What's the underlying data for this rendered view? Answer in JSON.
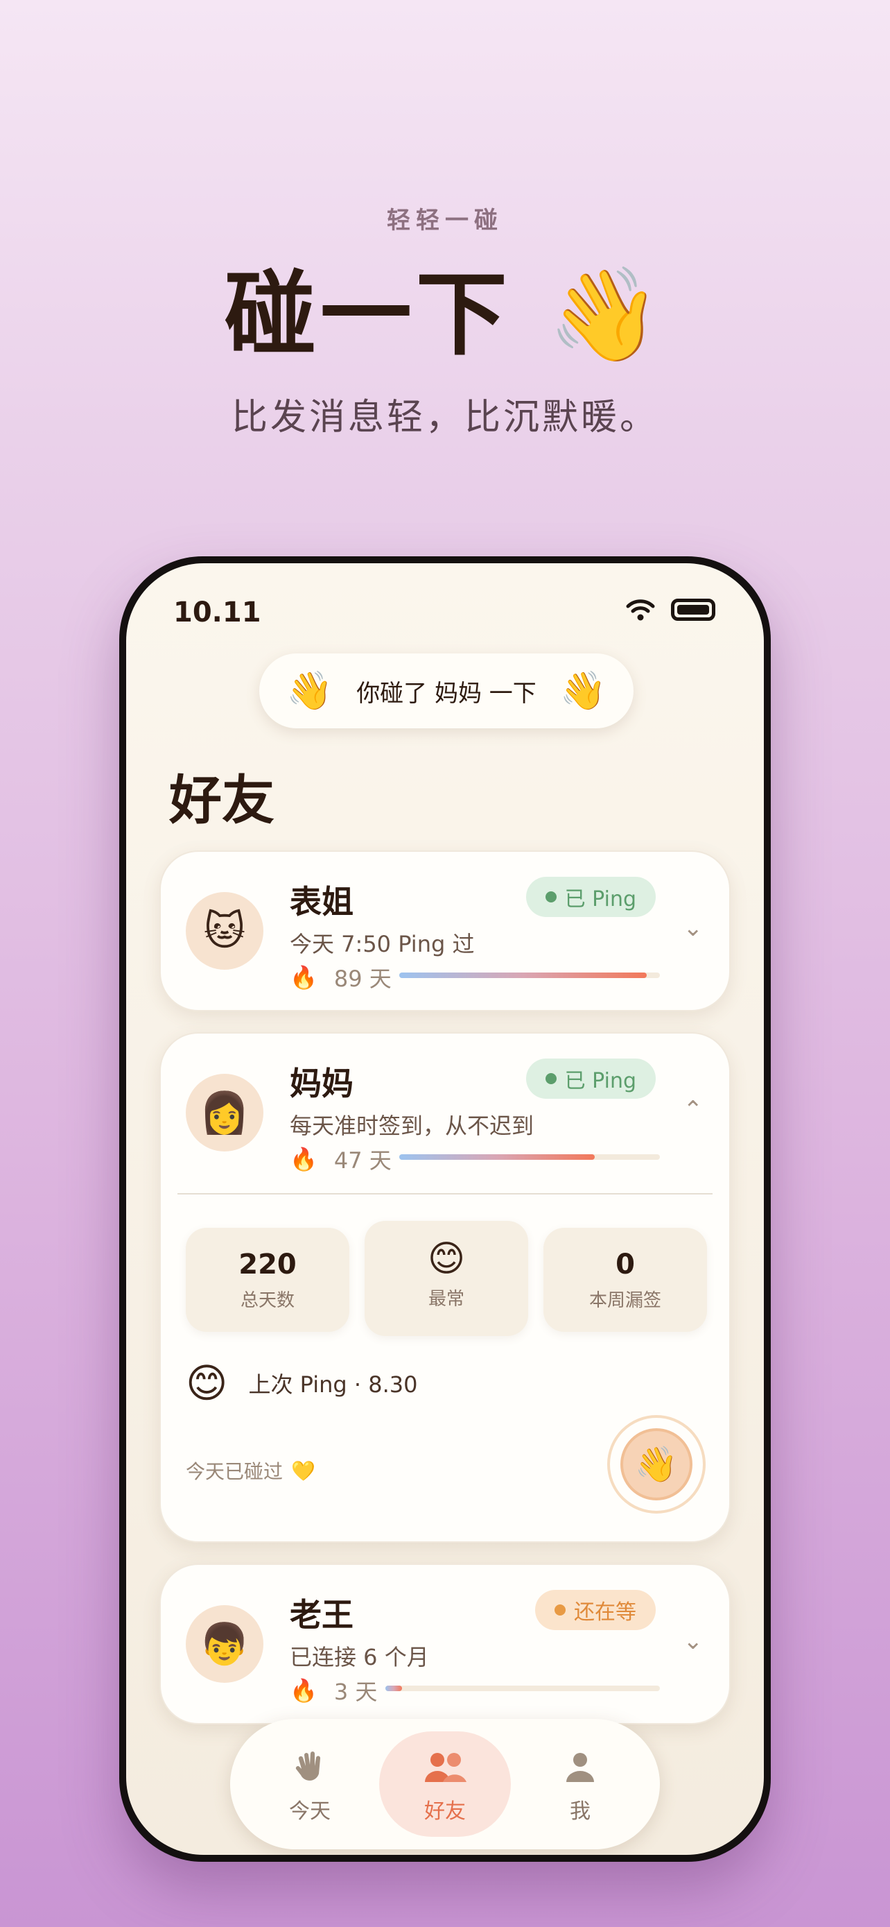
{
  "hero": {
    "kicker": "轻轻一碰",
    "headline": "碰一下 👋",
    "tagline": "比发消息轻，比沉默暖。"
  },
  "status_bar": {
    "time": "10.11"
  },
  "toast": {
    "left_emoji": "👋",
    "text": "你碰了 妈妈 一下",
    "right_emoji": "👋"
  },
  "section_title": "好友",
  "friends": [
    {
      "avatar": "🐱",
      "name": "表姐",
      "badge": "已 Ping",
      "badge_status": "pinged",
      "subtitle": "今天 7:50 Ping 过",
      "flame": "🔥",
      "streak": "89 天",
      "streak_progress": 0.95,
      "chevron": "⌄",
      "expanded": false
    },
    {
      "avatar": "👩",
      "name": "妈妈",
      "badge": "已 Ping",
      "badge_status": "pinged",
      "subtitle": "每天准时签到，从不迟到",
      "flame": "🔥",
      "streak": "47 天",
      "streak_progress": 0.75,
      "chevron": "⌃",
      "expanded": true,
      "stats": [
        {
          "value": "220",
          "label": "总天数"
        },
        {
          "emoji": "😊",
          "label": "最常"
        },
        {
          "value": "0",
          "label": "本周漏签"
        }
      ],
      "last_ping_emoji": "😊",
      "last_ping": "上次 Ping · 8.30",
      "today_note": "今天已碰过",
      "today_note_emoji": "💛",
      "wave_button_emoji": "👋"
    },
    {
      "avatar": "👦",
      "name": "老王",
      "badge": "还在等",
      "badge_status": "waiting",
      "subtitle": "已连接 6 个月",
      "flame": "🔥",
      "streak": "3 天",
      "streak_progress": 0.06,
      "chevron": "⌄",
      "expanded": false
    }
  ],
  "tabs": [
    {
      "label": "今天",
      "icon": "wave-hand-icon",
      "active": false
    },
    {
      "label": "好友",
      "icon": "friends-icon",
      "active": true
    },
    {
      "label": "我",
      "icon": "person-icon",
      "active": false
    }
  ],
  "colors": {
    "accent": "#E5704C",
    "success": "#5C9E6C",
    "warning": "#E08A3A",
    "ink": "#2D1A10"
  }
}
